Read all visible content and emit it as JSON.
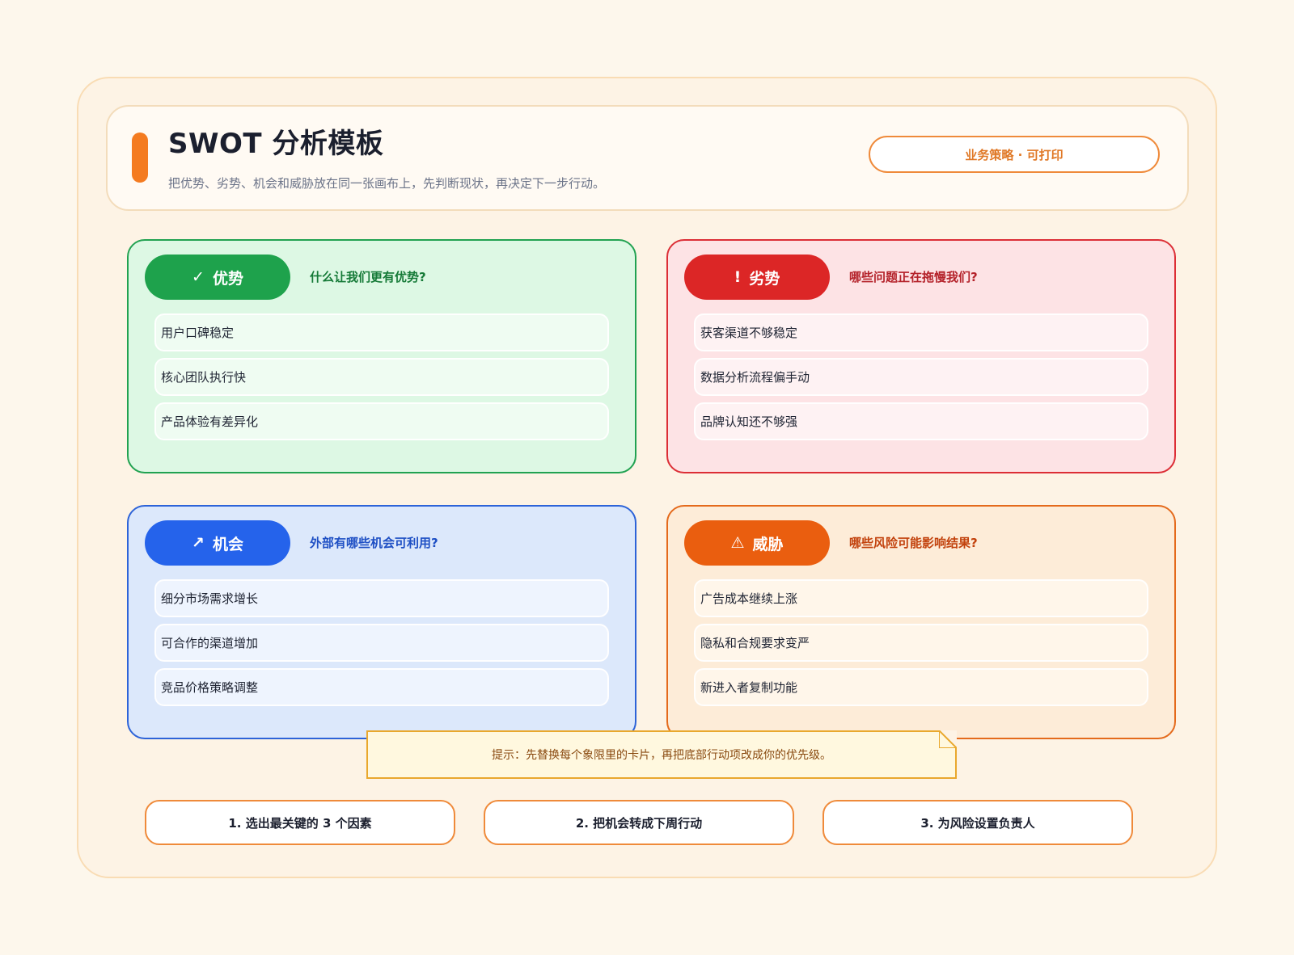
{
  "header": {
    "title": "SWOT 分析模板",
    "subtitle": "把优势、劣势、机会和威胁放在同一张画布上，先判断现状，再决定下一步行动。",
    "tag": "业务策略 · 可打印"
  },
  "quadrants": {
    "strengths": {
      "icon": "✓",
      "label": "优势",
      "question": "什么让我们更有优势?",
      "color": "#1ea24c",
      "items": [
        "用户口碑稳定",
        "核心团队执行快",
        "产品体验有差异化"
      ]
    },
    "weaknesses": {
      "icon": "!",
      "label": "劣势",
      "question": "哪些问题正在拖慢我们?",
      "color": "#dc2626",
      "items": [
        "获客渠道不够稳定",
        "数据分析流程偏手动",
        "品牌认知还不够强"
      ]
    },
    "opportunities": {
      "icon": "↗",
      "label": "机会",
      "question": "外部有哪些机会可利用?",
      "color": "#2563eb",
      "items": [
        "细分市场需求增长",
        "可合作的渠道增加",
        "竞品价格策略调整"
      ]
    },
    "threats": {
      "icon": "⚠",
      "label": "威胁",
      "question": "哪些风险可能影响结果?",
      "color": "#ea5e0f",
      "items": [
        "广告成本继续上涨",
        "隐私和合规要求变严",
        "新进入者复制功能"
      ]
    }
  },
  "note": "提示：先替换每个象限里的卡片，再把底部行动项改成你的优先级。",
  "actions": [
    "1. 选出最关键的 3 个因素",
    "2. 把机会转成下周行动",
    "3. 为风险设置负责人"
  ]
}
